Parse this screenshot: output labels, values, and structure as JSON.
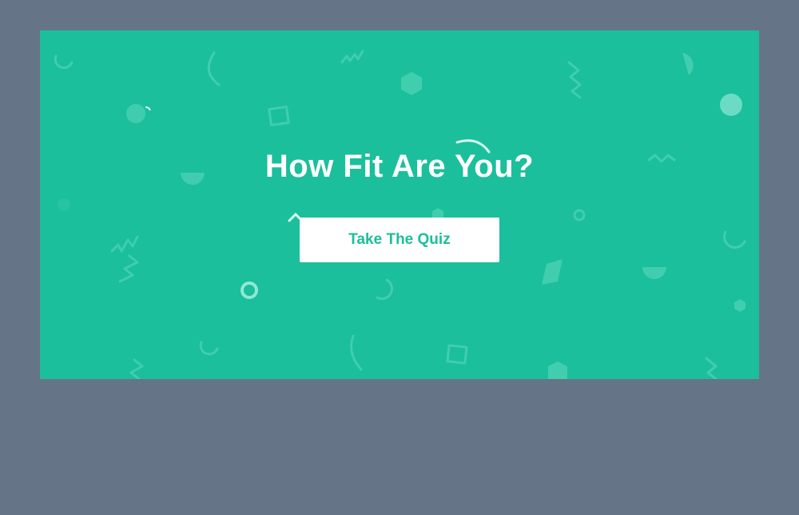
{
  "banner": {
    "title": "How Fit Are You?",
    "cta_label": "Take The Quiz",
    "background_color": "#1bbf9b",
    "page_background_color": "#667487",
    "cta_text_color": "#1bbf9b",
    "decoration": "confetti-shapes"
  }
}
